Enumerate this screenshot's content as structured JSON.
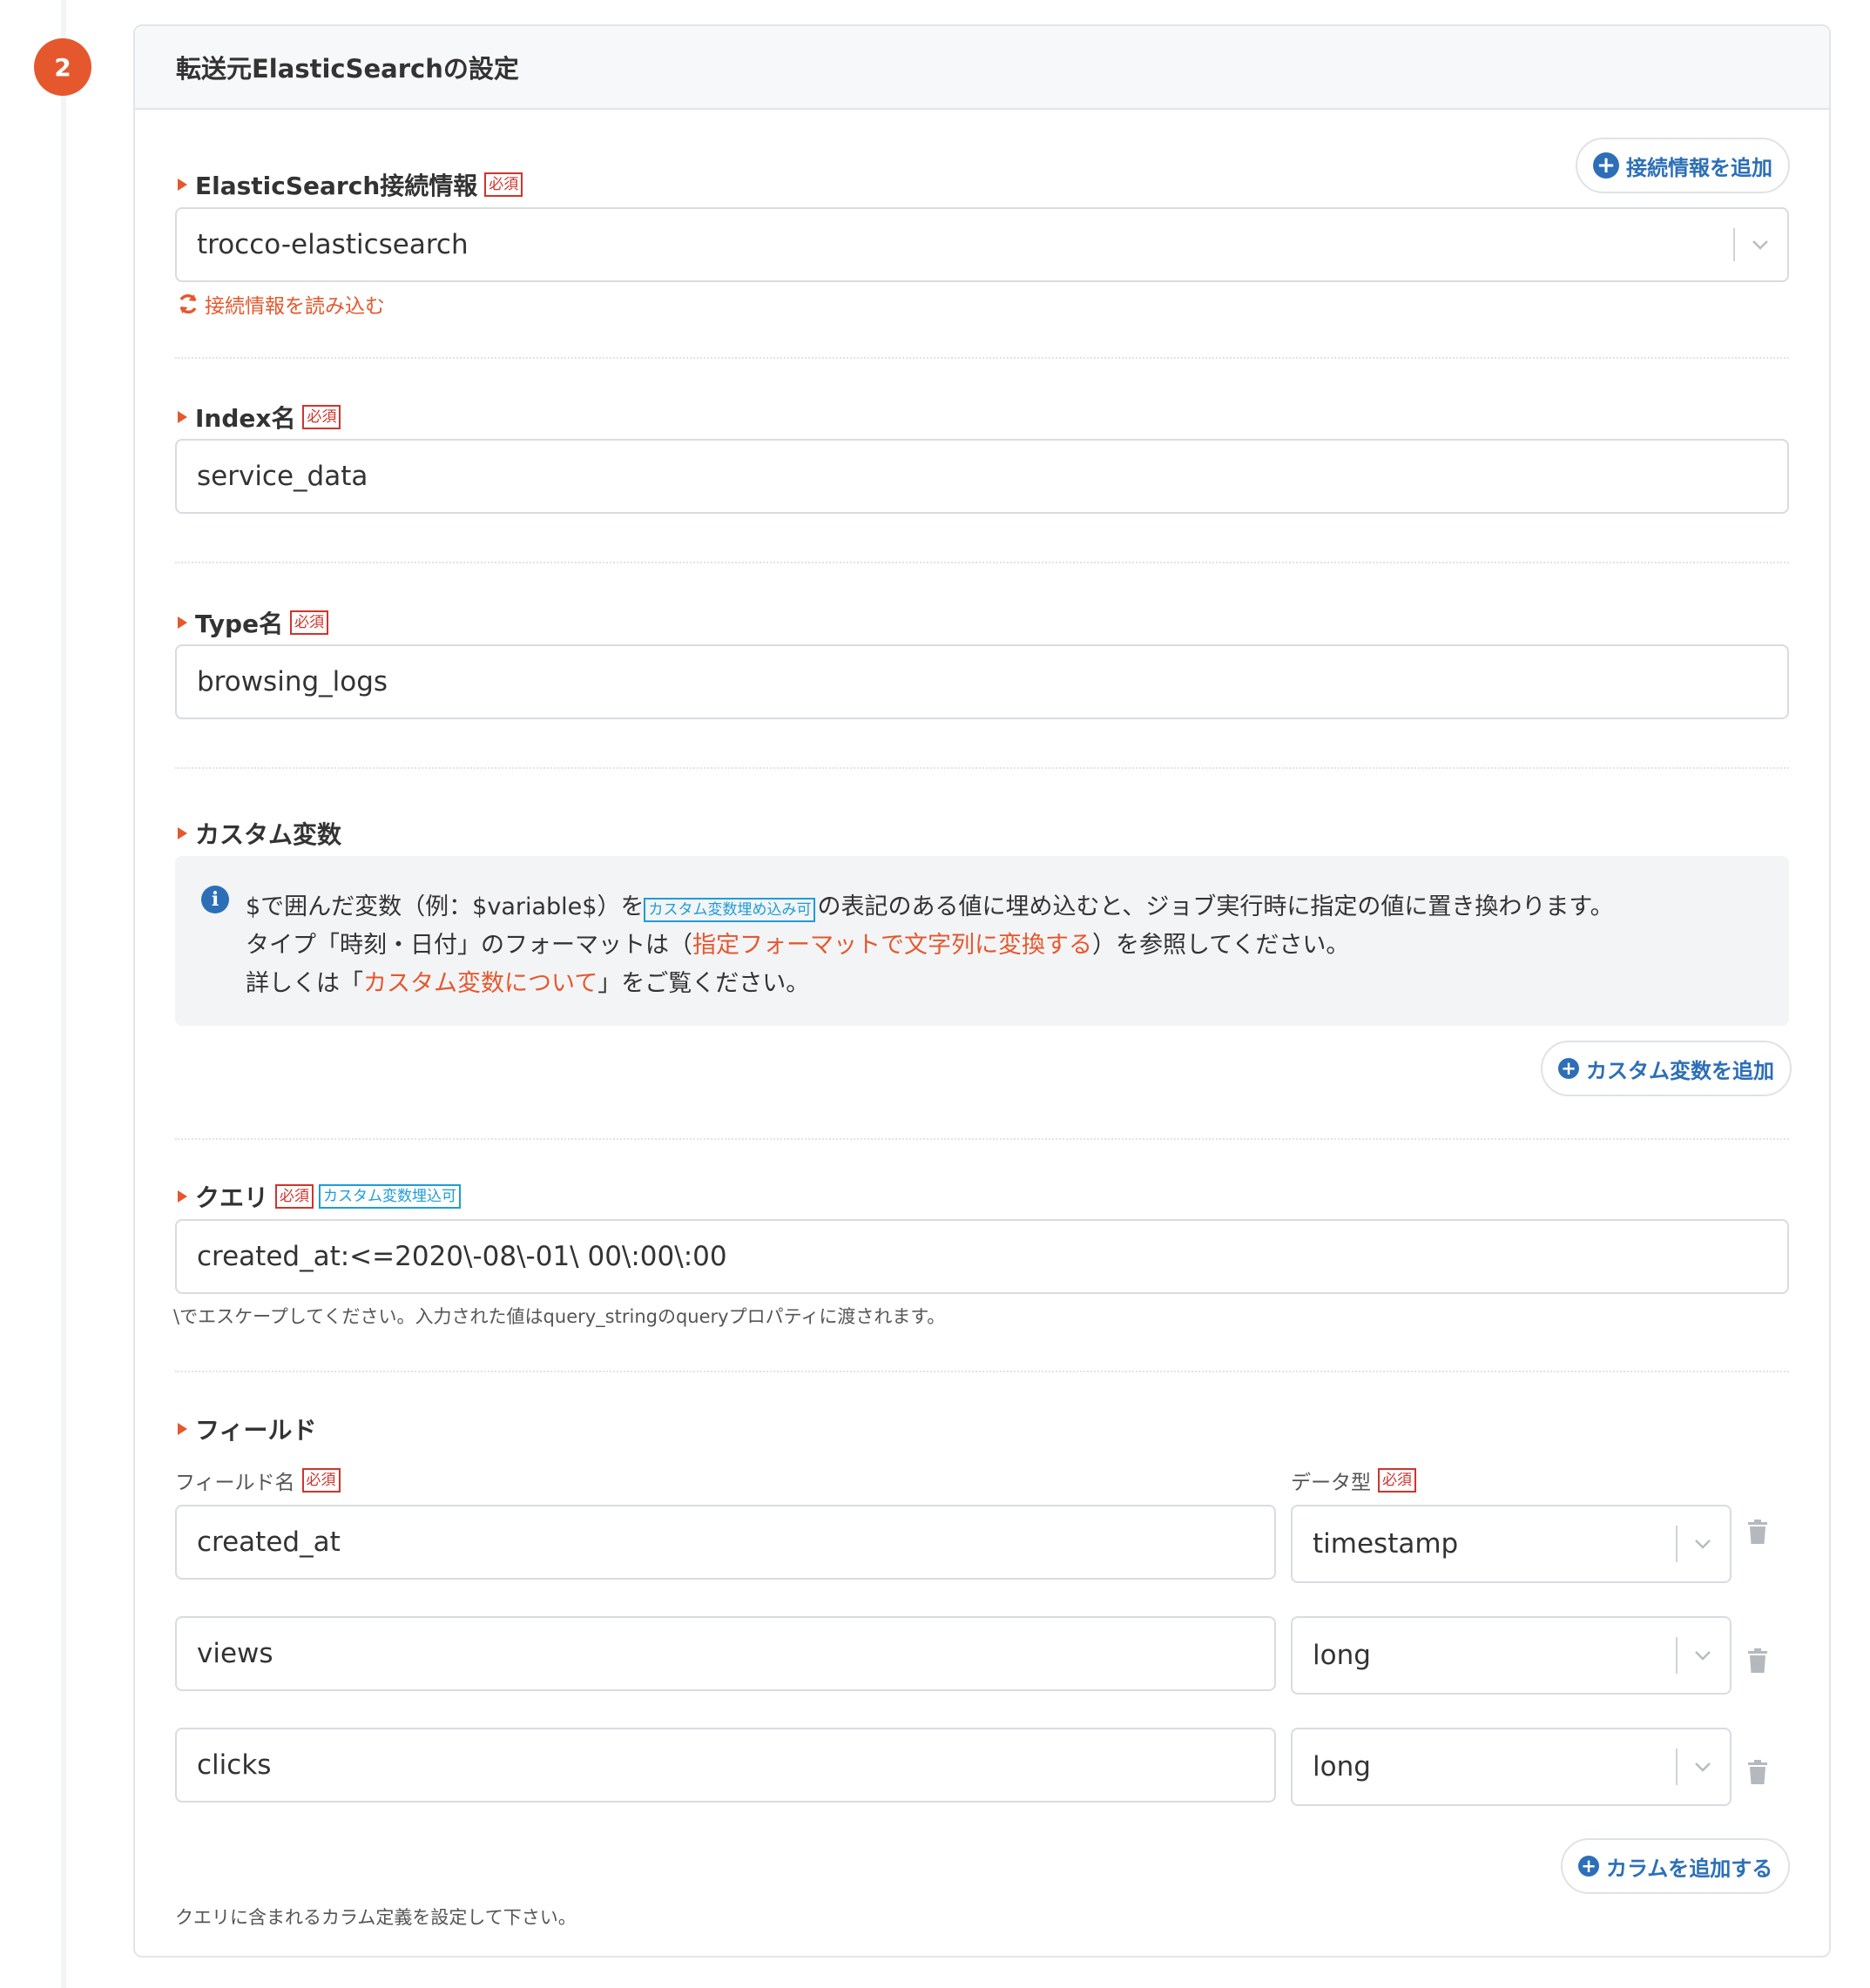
{
  "step_number": "2",
  "card_title": "転送元ElasticSearchの設定",
  "required_tag": "必須",
  "connection": {
    "label": "ElasticSearch接続情報",
    "add_button": "接続情報を追加",
    "selected": "trocco-elasticsearch",
    "reload_link": "接続情報を読み込む"
  },
  "index": {
    "label": "Index名",
    "value": "service_data"
  },
  "type": {
    "label": "Type名",
    "value": "browsing_logs"
  },
  "custom_vars": {
    "label": "カスタム変数",
    "info_line1_a": "$で囲んだ変数（例：$variable$）を",
    "info_line1_tag": "カスタム変数埋め込み可",
    "info_line1_b": "の表記のある値に埋め込むと、ジョブ実行時に指定の値に置き換わります。",
    "info_line2_a": "タイプ「時刻・日付」のフォーマットは（",
    "info_line2_link": "指定フォーマットで文字列に変換する",
    "info_line2_b": "）を参照してください。",
    "info_line3_a": "詳しくは「",
    "info_line3_link": "カスタム変数について",
    "info_line3_b": "」をご覧ください。",
    "add_button": "カスタム変数を追加"
  },
  "query": {
    "label": "クエリ",
    "var_tag": "カスタム変数埋込可",
    "value": "created_at:<=2020\\-08\\-01\\ 00\\:00\\:00",
    "hint": "\\でエスケープしてください。入力された値はquery_stringのqueryプロパティに渡されます。"
  },
  "fields": {
    "label": "フィールド",
    "name_header": "フィールド名",
    "type_header": "データ型",
    "rows": [
      {
        "name": "created_at",
        "type": "timestamp"
      },
      {
        "name": "views",
        "type": "long"
      },
      {
        "name": "clicks",
        "type": "long"
      }
    ],
    "add_button": "カラムを追加する",
    "footer_note": "クエリに含まれるカラム定義を設定して下さい。"
  }
}
